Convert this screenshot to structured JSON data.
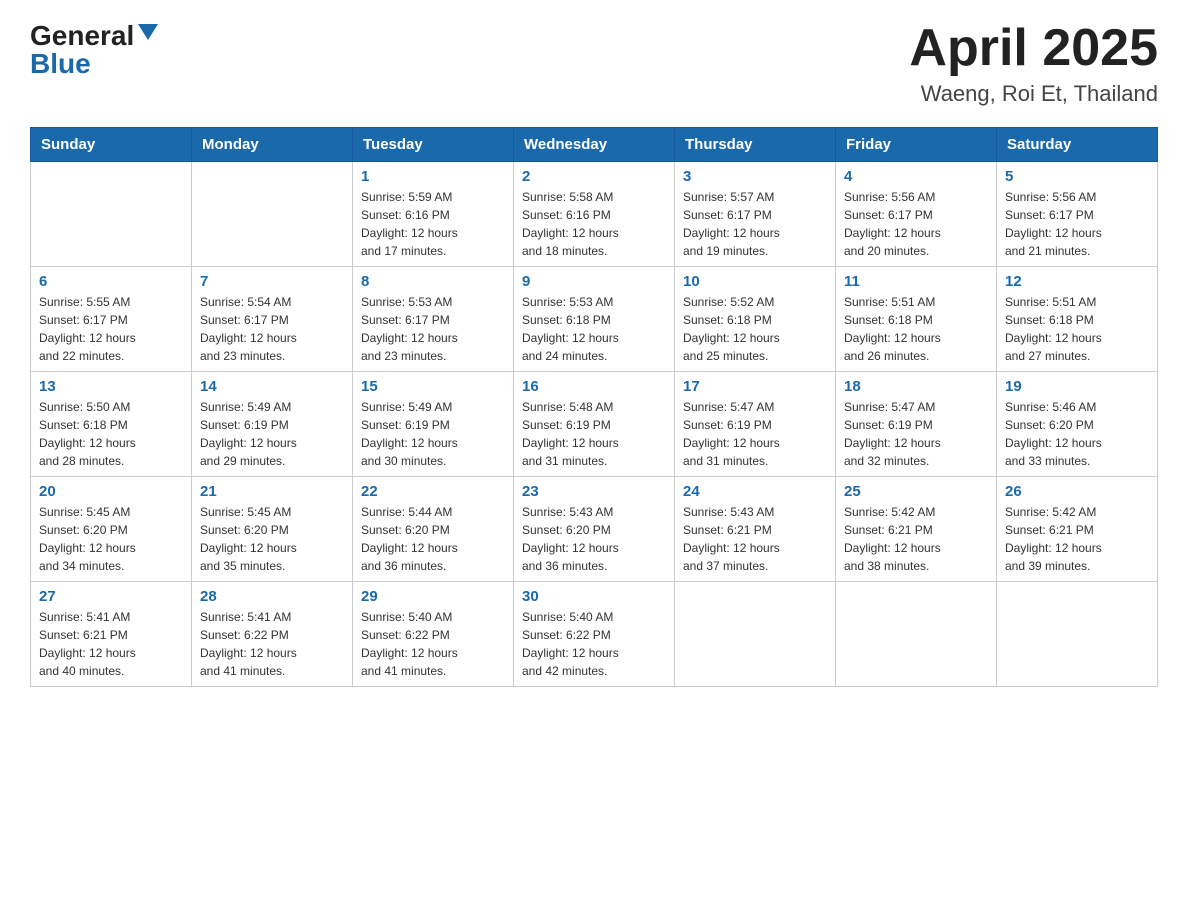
{
  "header": {
    "logo": {
      "general": "General",
      "blue": "Blue"
    },
    "title": "April 2025",
    "subtitle": "Waeng, Roi Et, Thailand"
  },
  "calendar": {
    "days_of_week": [
      "Sunday",
      "Monday",
      "Tuesday",
      "Wednesday",
      "Thursday",
      "Friday",
      "Saturday"
    ],
    "weeks": [
      [
        {
          "day": "",
          "info": ""
        },
        {
          "day": "",
          "info": ""
        },
        {
          "day": "1",
          "info": "Sunrise: 5:59 AM\nSunset: 6:16 PM\nDaylight: 12 hours\nand 17 minutes."
        },
        {
          "day": "2",
          "info": "Sunrise: 5:58 AM\nSunset: 6:16 PM\nDaylight: 12 hours\nand 18 minutes."
        },
        {
          "day": "3",
          "info": "Sunrise: 5:57 AM\nSunset: 6:17 PM\nDaylight: 12 hours\nand 19 minutes."
        },
        {
          "day": "4",
          "info": "Sunrise: 5:56 AM\nSunset: 6:17 PM\nDaylight: 12 hours\nand 20 minutes."
        },
        {
          "day": "5",
          "info": "Sunrise: 5:56 AM\nSunset: 6:17 PM\nDaylight: 12 hours\nand 21 minutes."
        }
      ],
      [
        {
          "day": "6",
          "info": "Sunrise: 5:55 AM\nSunset: 6:17 PM\nDaylight: 12 hours\nand 22 minutes."
        },
        {
          "day": "7",
          "info": "Sunrise: 5:54 AM\nSunset: 6:17 PM\nDaylight: 12 hours\nand 23 minutes."
        },
        {
          "day": "8",
          "info": "Sunrise: 5:53 AM\nSunset: 6:17 PM\nDaylight: 12 hours\nand 23 minutes."
        },
        {
          "day": "9",
          "info": "Sunrise: 5:53 AM\nSunset: 6:18 PM\nDaylight: 12 hours\nand 24 minutes."
        },
        {
          "day": "10",
          "info": "Sunrise: 5:52 AM\nSunset: 6:18 PM\nDaylight: 12 hours\nand 25 minutes."
        },
        {
          "day": "11",
          "info": "Sunrise: 5:51 AM\nSunset: 6:18 PM\nDaylight: 12 hours\nand 26 minutes."
        },
        {
          "day": "12",
          "info": "Sunrise: 5:51 AM\nSunset: 6:18 PM\nDaylight: 12 hours\nand 27 minutes."
        }
      ],
      [
        {
          "day": "13",
          "info": "Sunrise: 5:50 AM\nSunset: 6:18 PM\nDaylight: 12 hours\nand 28 minutes."
        },
        {
          "day": "14",
          "info": "Sunrise: 5:49 AM\nSunset: 6:19 PM\nDaylight: 12 hours\nand 29 minutes."
        },
        {
          "day": "15",
          "info": "Sunrise: 5:49 AM\nSunset: 6:19 PM\nDaylight: 12 hours\nand 30 minutes."
        },
        {
          "day": "16",
          "info": "Sunrise: 5:48 AM\nSunset: 6:19 PM\nDaylight: 12 hours\nand 31 minutes."
        },
        {
          "day": "17",
          "info": "Sunrise: 5:47 AM\nSunset: 6:19 PM\nDaylight: 12 hours\nand 31 minutes."
        },
        {
          "day": "18",
          "info": "Sunrise: 5:47 AM\nSunset: 6:19 PM\nDaylight: 12 hours\nand 32 minutes."
        },
        {
          "day": "19",
          "info": "Sunrise: 5:46 AM\nSunset: 6:20 PM\nDaylight: 12 hours\nand 33 minutes."
        }
      ],
      [
        {
          "day": "20",
          "info": "Sunrise: 5:45 AM\nSunset: 6:20 PM\nDaylight: 12 hours\nand 34 minutes."
        },
        {
          "day": "21",
          "info": "Sunrise: 5:45 AM\nSunset: 6:20 PM\nDaylight: 12 hours\nand 35 minutes."
        },
        {
          "day": "22",
          "info": "Sunrise: 5:44 AM\nSunset: 6:20 PM\nDaylight: 12 hours\nand 36 minutes."
        },
        {
          "day": "23",
          "info": "Sunrise: 5:43 AM\nSunset: 6:20 PM\nDaylight: 12 hours\nand 36 minutes."
        },
        {
          "day": "24",
          "info": "Sunrise: 5:43 AM\nSunset: 6:21 PM\nDaylight: 12 hours\nand 37 minutes."
        },
        {
          "day": "25",
          "info": "Sunrise: 5:42 AM\nSunset: 6:21 PM\nDaylight: 12 hours\nand 38 minutes."
        },
        {
          "day": "26",
          "info": "Sunrise: 5:42 AM\nSunset: 6:21 PM\nDaylight: 12 hours\nand 39 minutes."
        }
      ],
      [
        {
          "day": "27",
          "info": "Sunrise: 5:41 AM\nSunset: 6:21 PM\nDaylight: 12 hours\nand 40 minutes."
        },
        {
          "day": "28",
          "info": "Sunrise: 5:41 AM\nSunset: 6:22 PM\nDaylight: 12 hours\nand 41 minutes."
        },
        {
          "day": "29",
          "info": "Sunrise: 5:40 AM\nSunset: 6:22 PM\nDaylight: 12 hours\nand 41 minutes."
        },
        {
          "day": "30",
          "info": "Sunrise: 5:40 AM\nSunset: 6:22 PM\nDaylight: 12 hours\nand 42 minutes."
        },
        {
          "day": "",
          "info": ""
        },
        {
          "day": "",
          "info": ""
        },
        {
          "day": "",
          "info": ""
        }
      ]
    ]
  }
}
